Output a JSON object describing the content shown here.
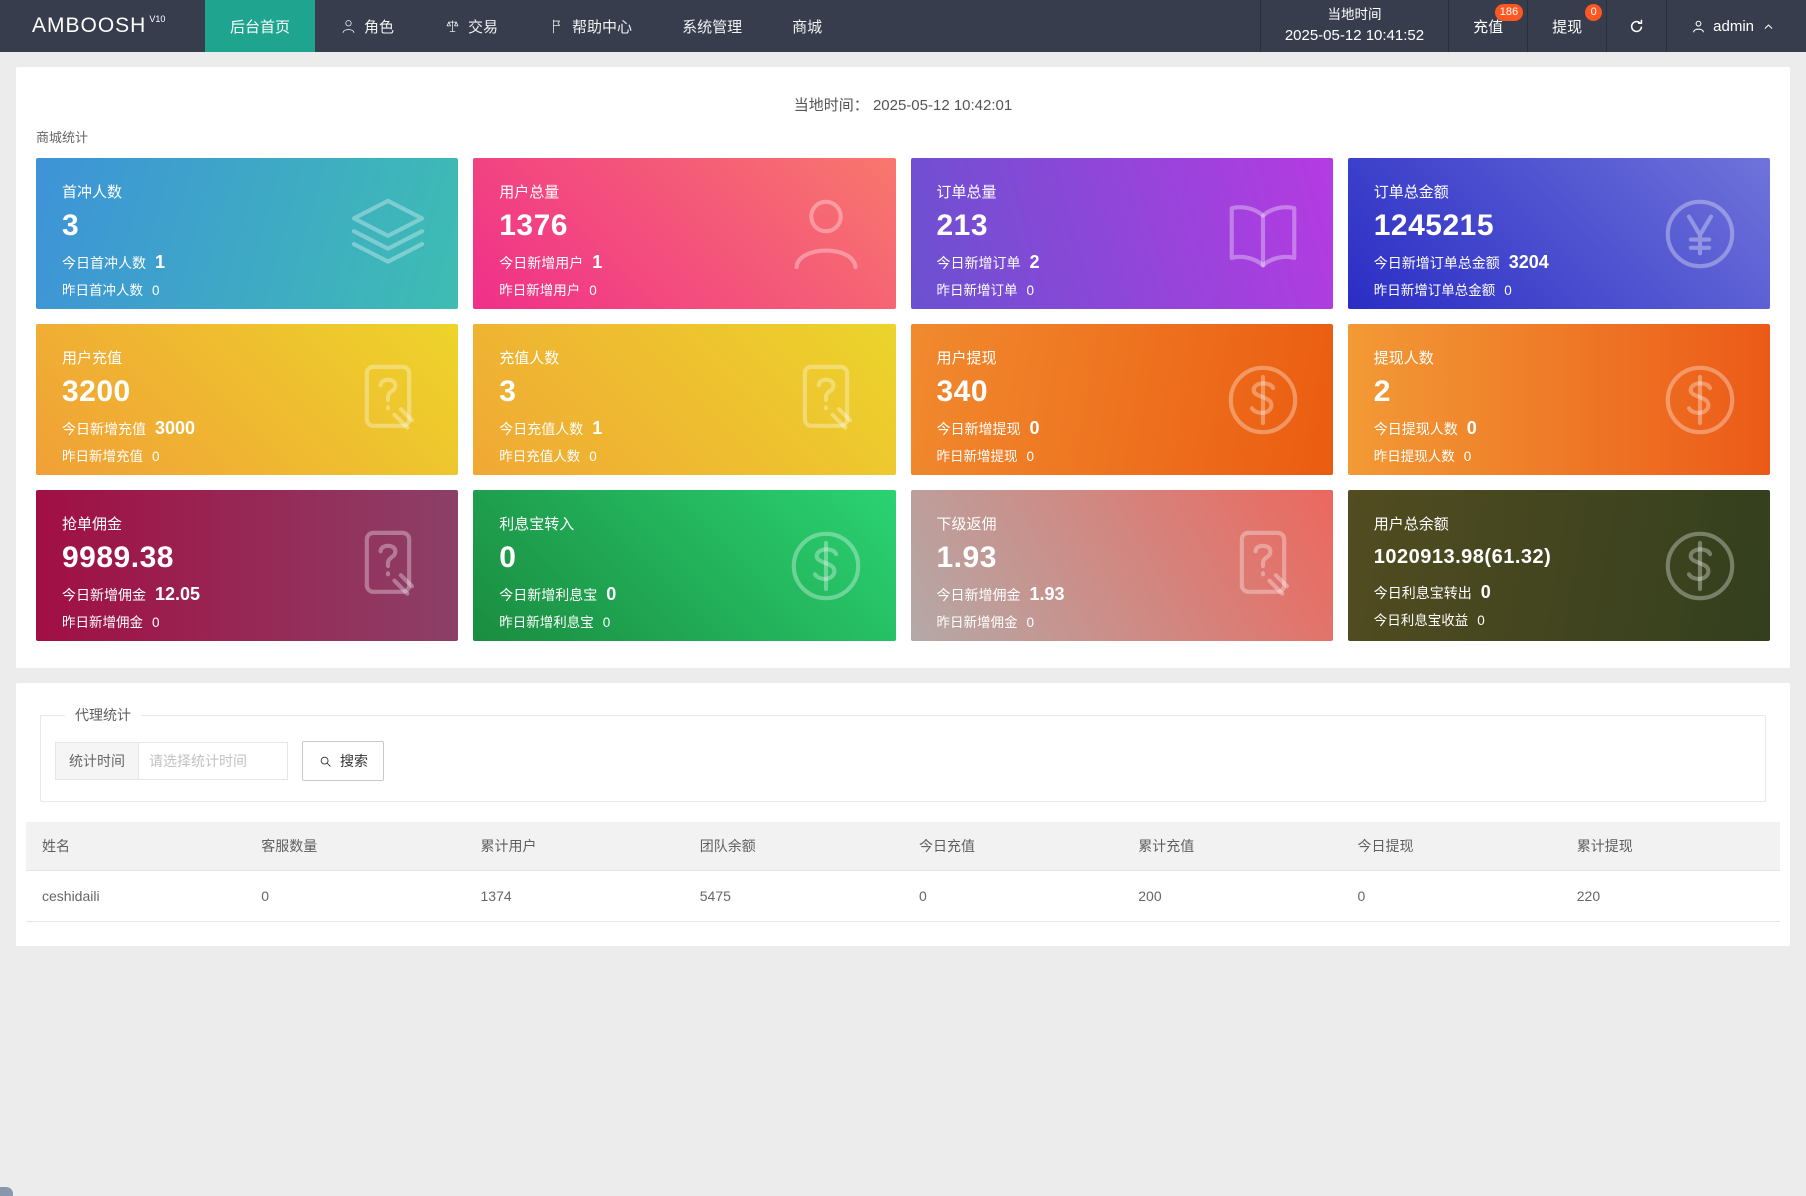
{
  "colors": {
    "navbar_bg": "#373d4d",
    "accent_active_tab": "#1fa58f",
    "badge": "#ff5722",
    "page_bg": "#ececec"
  },
  "navbar": {
    "logo": "AMBOOSH",
    "logo_sup": "V10",
    "menu": [
      {
        "label": "后台首页",
        "active": true
      },
      {
        "label": "角色",
        "icon": "user-icon"
      },
      {
        "label": "交易",
        "icon": "scales-icon"
      },
      {
        "label": "帮助中心",
        "icon": "flag-icon"
      },
      {
        "label": "系统管理"
      },
      {
        "label": "商城"
      }
    ],
    "local_time": {
      "label": "当地时间",
      "value": "2025-05-12 10:41:52"
    },
    "actions": {
      "recharge": {
        "label": "充值",
        "badge": "186"
      },
      "withdraw": {
        "label": "提现",
        "badge": "0"
      }
    },
    "user": {
      "name": "admin"
    }
  },
  "overview": {
    "time_label": "当地时间：",
    "time_value": "2025-05-12 10:42:01",
    "section_title": "商城统计",
    "cards": [
      {
        "title": "首冲人数",
        "value": "3",
        "line2_label": "今日首冲人数",
        "line2_value": "1",
        "line3_label": "昨日首冲人数",
        "line3_value": "0",
        "icon": "layers-icon",
        "angle": "105deg",
        "gradient": [
          "#3E93D8",
          "#3EBDB3"
        ]
      },
      {
        "title": "用户总量",
        "value": "1376",
        "line2_label": "今日新增用户",
        "line2_value": "1",
        "line3_label": "昨日新增用户",
        "line3_value": "0",
        "icon": "user-icon",
        "angle": "45deg",
        "gradient": [
          "#F02F8A",
          "#F8786C"
        ]
      },
      {
        "title": "订单总量",
        "value": "213",
        "line2_label": "今日新增订单",
        "line2_value": "2",
        "line3_label": "昨日新增订单",
        "line3_value": "0",
        "icon": "book-icon",
        "angle": "75deg",
        "gradient": [
          "#6B51D0",
          "#B53BE2"
        ]
      },
      {
        "title": "订单总金额",
        "value": "1245215",
        "line2_label": "今日新增订单总金额",
        "line2_value": "3204",
        "line3_label": "昨日新增订单总金额",
        "line3_value": "0",
        "icon": "yen-circle-icon",
        "angle": "45deg",
        "gradient": [
          "#2A2DC4",
          "#6F73DA"
        ]
      },
      {
        "title": "用户充值",
        "value": "3200",
        "line2_label": "今日新增充值",
        "line2_value": "3000",
        "line3_label": "昨日新增充值",
        "line3_value": "0",
        "icon": "contract-icon",
        "angle": "45deg",
        "gradient": [
          "#F1A037",
          "#EDD42A"
        ]
      },
      {
        "title": "充值人数",
        "value": "3",
        "line2_label": "今日充值人数",
        "line2_value": "1",
        "line3_label": "昨日充值人数",
        "line3_value": "0",
        "icon": "contract-icon",
        "angle": "45deg",
        "gradient": [
          "#F0A835",
          "#ECD42B"
        ]
      },
      {
        "title": "用户提现",
        "value": "340",
        "line2_label": "今日新增提现",
        "line2_value": "0",
        "line3_label": "昨日新增提现",
        "line3_value": "0",
        "icon": "dollar-circle-icon",
        "angle": "100deg",
        "gradient": [
          "#F18A2F",
          "#EB5C10"
        ]
      },
      {
        "title": "提现人数",
        "value": "2",
        "line2_label": "今日提现人数",
        "line2_value": "0",
        "line3_label": "昨日提现人数",
        "line3_value": "0",
        "icon": "dollar-circle-icon",
        "angle": "90deg",
        "gradient": [
          "#F29A36",
          "#EC5A18"
        ]
      },
      {
        "title": "抢单佣金",
        "value": "9989.38",
        "line2_label": "今日新增佣金",
        "line2_value": "12.05",
        "line3_label": "昨日新增佣金",
        "line3_value": "0",
        "icon": "contract-icon",
        "angle": "90deg",
        "gradient": [
          "#A10F43",
          "#8C4067"
        ]
      },
      {
        "title": "利息宝转入",
        "value": "0",
        "line2_label": "今日新增利息宝",
        "line2_value": "0",
        "line3_label": "昨日新增利息宝",
        "line3_value": "0",
        "icon": "dollar-circle-icon",
        "angle": "45deg",
        "gradient": [
          "#1A8C40",
          "#2BD372"
        ]
      },
      {
        "title": "下级返佣",
        "value": "1.93",
        "line2_label": "今日新增佣金",
        "line2_value": "1.93",
        "line3_label": "昨日新增佣金",
        "line3_value": "0",
        "icon": "contract-icon",
        "angle": "60deg",
        "gradient": [
          "#B4A9A7",
          "#EC685E"
        ]
      },
      {
        "title": "用户总余额",
        "value": "1020913.98(61.32)",
        "line2_label": "今日利息宝转出",
        "line2_value": "0",
        "line3_label": "今日利息宝收益",
        "line3_value": "0",
        "icon": "dollar-circle-icon",
        "angle": "100deg",
        "gradient": [
          "#524C20",
          "#333F1E"
        ]
      }
    ]
  },
  "agent": {
    "section_title": "代理统计",
    "filter": {
      "label": "统计时间",
      "placeholder": "请选择统计时间"
    },
    "search_label": "搜索",
    "table": {
      "headers": [
        "姓名",
        "客服数量",
        "累计用户",
        "团队余额",
        "今日充值",
        "累计充值",
        "今日提现",
        "累计提现"
      ],
      "rows": [
        [
          "ceshidaili",
          "0",
          "1374",
          "5475",
          "0",
          "200",
          "0",
          "220"
        ]
      ]
    }
  }
}
